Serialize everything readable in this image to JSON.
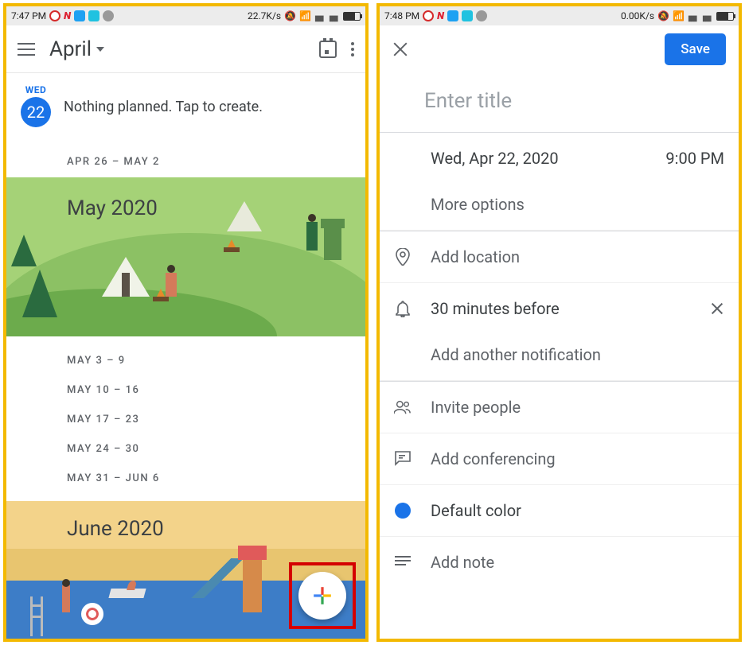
{
  "status_left": {
    "time": "7:47 PM",
    "speed": "22.7K/s"
  },
  "status_right": {
    "time": "7:48 PM",
    "speed": "0.00K/s"
  },
  "calendar": {
    "month_label": "April",
    "today": {
      "dow": "WED",
      "num": "22",
      "empty": "Nothing planned. Tap to create."
    },
    "range1": "APR 26 – MAY 2",
    "may_title": "May 2020",
    "weeks": [
      "MAY 3 – 9",
      "MAY 10 – 16",
      "MAY 17 – 23",
      "MAY 24 – 30",
      "MAY 31 – JUN 6"
    ],
    "june_title": "June 2020"
  },
  "form": {
    "title_placeholder": "Enter title",
    "save": "Save",
    "date": "Wed, Apr 22, 2020",
    "time": "9:00 PM",
    "more_options": "More options",
    "add_location": "Add location",
    "notification": "30 minutes before",
    "add_notification": "Add another notification",
    "invite": "Invite people",
    "conferencing": "Add conferencing",
    "color": "Default color",
    "note": "Add note"
  }
}
